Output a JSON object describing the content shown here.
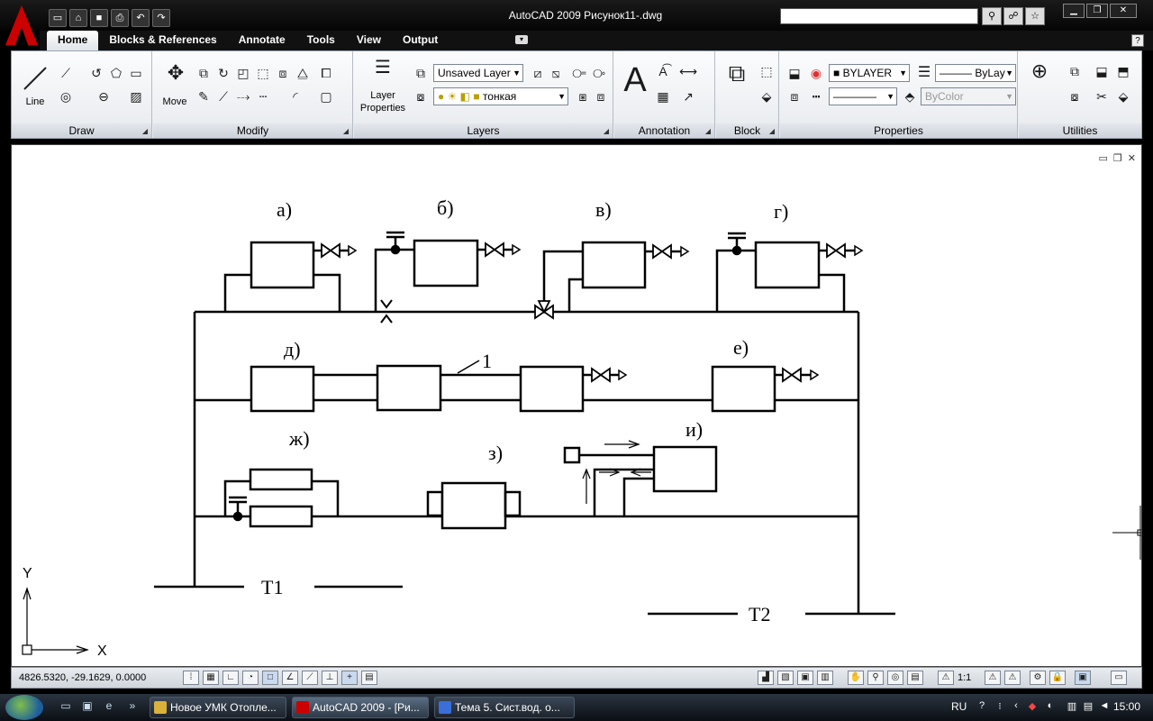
{
  "window": {
    "title": "AutoCAD 2009 Рисунок11-.dwg",
    "search_placeholder": ""
  },
  "ribbon_tabs": [
    {
      "label": "Home"
    },
    {
      "label": "Blocks & References"
    },
    {
      "label": "Annotate"
    },
    {
      "label": "Tools"
    },
    {
      "label": "View"
    },
    {
      "label": "Output"
    }
  ],
  "panels": {
    "draw": {
      "title": "Draw",
      "line_label": "Line"
    },
    "modify": {
      "title": "Modify",
      "move_label": "Move"
    },
    "layers": {
      "title": "Layers",
      "properties_label": "Layer Properties",
      "layer_combo": "Unsaved Layer",
      "current_layer": "тонкая"
    },
    "annotation": {
      "title": "Annotation",
      "text_glyph": "A"
    },
    "block": {
      "title": "Block"
    },
    "properties": {
      "title": "Properties",
      "color": "BYLAYER",
      "lineweight": "ByLay",
      "plotstyle": "ByColor"
    },
    "utilities": {
      "title": "Utilities"
    }
  },
  "drawing": {
    "labels": {
      "a": "а)",
      "b": "б)",
      "v": "в)",
      "g": "г)",
      "d": "д)",
      "e": "е)",
      "zh": "ж)",
      "z": "з)",
      "i": "и)",
      "one": "1",
      "t1": "Т1",
      "t2": "Т2"
    },
    "ucs": {
      "x": "X",
      "y": "Y"
    }
  },
  "status": {
    "coordinates": "4826.5320, -29.1629, 0.0000",
    "scale": "1:1"
  },
  "taskbar": {
    "tasks": [
      {
        "label": "Новое УМК Отопле..."
      },
      {
        "label": "AutoCAD 2009 - [Ри..."
      },
      {
        "label": "Тема 5. Сист.вод. о..."
      }
    ],
    "language": "RU",
    "clock": "15:00"
  },
  "colors": {
    "accent": "#c00000",
    "ribbon_bg": "#eef0f3",
    "titlebar": "#0a0a0a"
  }
}
